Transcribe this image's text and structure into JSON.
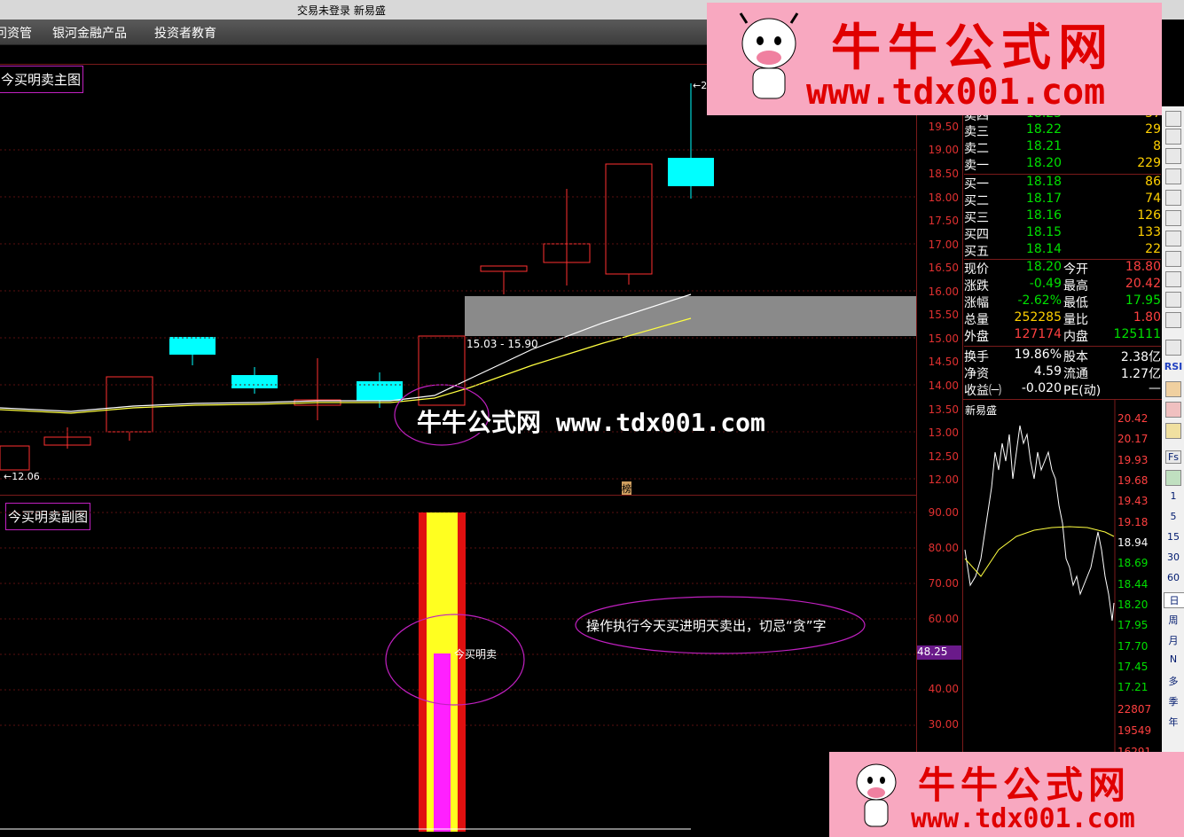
{
  "window": {
    "title": "交易未登录  新易盛"
  },
  "menu": {
    "items": [
      "问资管",
      "银河金融产品",
      "投资者教育"
    ]
  },
  "main_chart": {
    "title": "今买明卖主图",
    "range_label": "15.03 - 15.90",
    "low_marker": "←12.06",
    "high_marker": "←2",
    "bottom_tag": "榜",
    "watermark": "牛牛公式网 www.tdx001.com",
    "y_axis": [
      "19.50",
      "19.00",
      "18.50",
      "18.00",
      "17.50",
      "17.00",
      "16.50",
      "16.00",
      "15.50",
      "15.00",
      "14.50",
      "14.00",
      "13.50",
      "13.00",
      "12.50",
      "12.00"
    ]
  },
  "sub_chart": {
    "title": "今买明卖副图",
    "indicator_label": "今买明卖",
    "annotation": "操作执行今天买进明天卖出，切忌“贪”字",
    "current_value": "48.25",
    "y_axis": [
      "90.00",
      "80.00",
      "70.00",
      "60.00",
      "40.00",
      "30.00"
    ]
  },
  "quotes": {
    "ask_partial": {
      "label": "卖四",
      "price": "18.23",
      "vol": "37"
    },
    "asks": [
      {
        "label": "卖三",
        "price": "18.22",
        "vol": "29"
      },
      {
        "label": "卖二",
        "price": "18.21",
        "vol": "8"
      },
      {
        "label": "卖一",
        "price": "18.20",
        "vol": "229"
      }
    ],
    "bids": [
      {
        "label": "买一",
        "price": "18.18",
        "vol": "86"
      },
      {
        "label": "买二",
        "price": "18.17",
        "vol": "74"
      },
      {
        "label": "买三",
        "price": "18.16",
        "vol": "126"
      },
      {
        "label": "买四",
        "price": "18.15",
        "vol": "133"
      },
      {
        "label": "买五",
        "price": "18.14",
        "vol": "22"
      }
    ],
    "stats": [
      {
        "l1": "现价",
        "v1": "18.20",
        "l2": "今开",
        "v2": "18.80"
      },
      {
        "l1": "涨跌",
        "v1": "-0.49",
        "l2": "最高",
        "v2": "20.42"
      },
      {
        "l1": "涨幅",
        "v1": "-2.62%",
        "l2": "最低",
        "v2": "17.95"
      },
      {
        "l1": "总量",
        "v1": "252285",
        "l2": "量比",
        "v2": "1.80"
      },
      {
        "l1": "外盘",
        "v1": "127174",
        "l2": "内盘",
        "v2": "125111"
      },
      {
        "l1": "换手",
        "v1": "19.86%",
        "l2": "股本",
        "v2": "2.38亿"
      },
      {
        "l1": "净资",
        "v1": "4.59",
        "l2": "流通",
        "v2": "1.27亿"
      },
      {
        "l1": "收益㈠",
        "v1": "-0.020",
        "l2": "PE(动)",
        "v2": "—"
      }
    ]
  },
  "minute_chart": {
    "title": "新易盛",
    "y_axis": [
      "20.42",
      "20.17",
      "19.93",
      "19.68",
      "19.43",
      "19.18",
      "18.94",
      "18.69",
      "18.44",
      "18.20",
      "17.95",
      "17.70",
      "17.45",
      "17.21"
    ],
    "vol_axis": [
      "22807",
      "19549",
      "16291"
    ]
  },
  "side_periods": [
    "1",
    "5",
    "15",
    "30",
    "60",
    "日",
    "周",
    "月",
    "N",
    "多",
    "季",
    "年"
  ],
  "side_tools": [
    "Fs",
    "RSI"
  ],
  "logo": {
    "brand": "牛牛公式网",
    "url": "www.tdx001.com"
  },
  "colors": {
    "up": "#ff3030",
    "down": "#00ffff",
    "ma1": "#ffffff",
    "ma2": "#ffff40",
    "accent": "#c020c0"
  }
}
